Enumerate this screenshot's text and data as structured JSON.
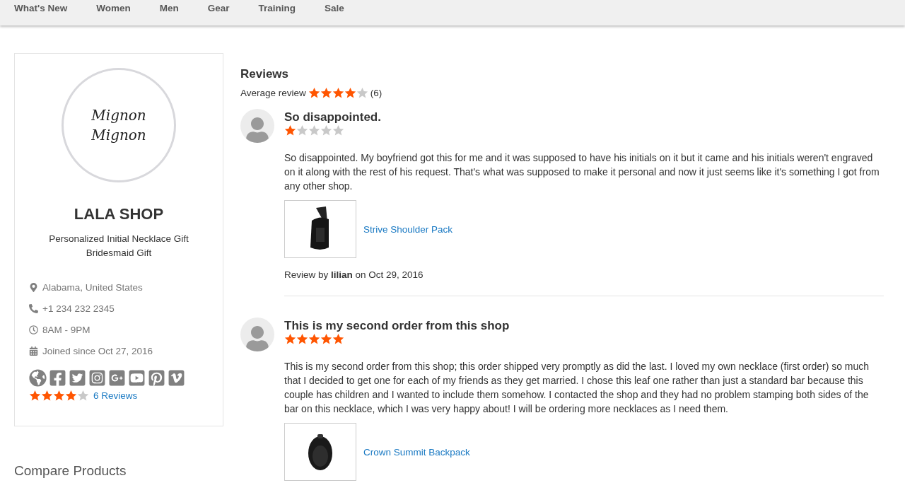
{
  "nav": [
    "What's New",
    "Women",
    "Men",
    "Gear",
    "Training",
    "Sale"
  ],
  "shop": {
    "logo_lines": [
      "Mignon",
      "Mignon"
    ],
    "name": "LALA SHOP",
    "tagline": "Personalized Initial Necklace Gift Bridesmaid Gift",
    "info": [
      {
        "kind": "location",
        "text": "Alabama, United States"
      },
      {
        "kind": "phone",
        "text": "+1 234 232 2345"
      },
      {
        "kind": "hours",
        "text": "8AM - 9PM"
      },
      {
        "kind": "joined",
        "text": "Joined since Oct 27, 2016"
      }
    ],
    "social": [
      {
        "kind": "website"
      },
      {
        "kind": "facebook"
      },
      {
        "kind": "twitter"
      },
      {
        "kind": "instagram"
      },
      {
        "kind": "googleplus"
      },
      {
        "kind": "youtube"
      },
      {
        "kind": "pinterest"
      },
      {
        "kind": "vimeo"
      }
    ],
    "stars": 4,
    "reviews_link": "6 Reviews"
  },
  "compare_title": "Compare Products",
  "reviews": {
    "title": "Reviews",
    "average_label": "Average review",
    "stars": 4,
    "count": "(6)",
    "items": [
      {
        "title": "So disappointed.",
        "stars": 1,
        "text": "So disappointed. My boyfriend got this for me and it was supposed to have his initials on it but it came and his initials weren't engraved on it along with the rest of his request. That's what was supposed to make it personal and now it just seems like it's something I got from any other shop.",
        "product": {
          "kind": "sling",
          "name": "Strive Shoulder Pack"
        },
        "byline": "Review by **lilian** on Oct 29, 2016"
      },
      {
        "title": "This is my second order from this shop",
        "stars": 5,
        "text": "This is my second order from this shop; this order shipped very promptly as did the last. I loved my own necklace (first order) so much that I decided to get one for each of my friends as they get married. I chose this leaf one rather than just a standard bar because this couple has children and I wanted to include them somehow. I contacted the shop and they had no problem stamping both sides of the bar on this necklace, which I was very happy about! I will be ordering more necklaces as I need them.",
        "product": {
          "kind": "backpack",
          "name": "Crown Summit Backpack"
        }
      }
    ]
  }
}
